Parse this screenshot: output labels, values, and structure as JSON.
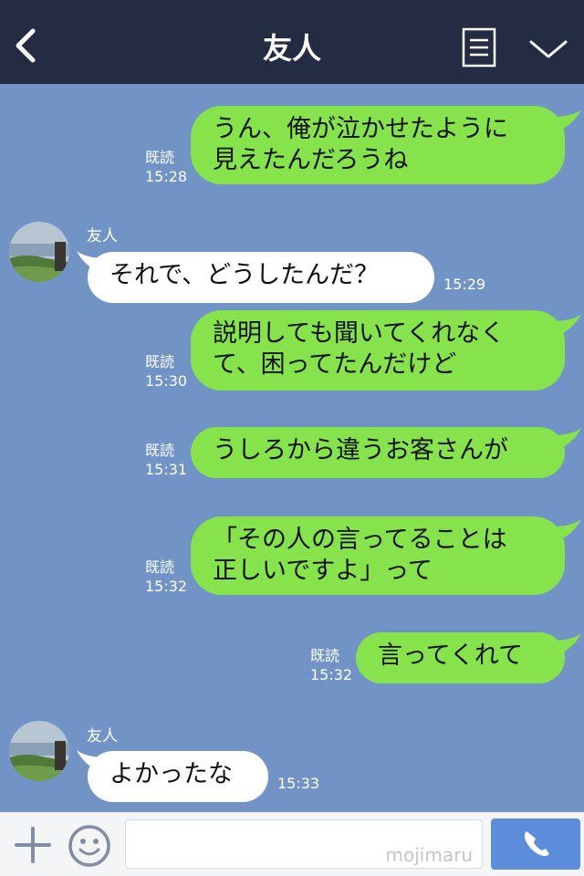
{
  "header": {
    "title": "友人",
    "back_icon": "chevron-left-icon",
    "menu_icon": "menu-icon",
    "collapse_icon": "chevron-down-icon"
  },
  "messages": [
    {
      "side": "out",
      "lines": [
        "うん、俺が泣かせたように",
        "見えたんだろうね"
      ],
      "read": "既読",
      "time": "15:28"
    },
    {
      "side": "in",
      "sender": "友人",
      "lines": [
        "それで、どうしたんだ？"
      ],
      "time": "15:29"
    },
    {
      "side": "out",
      "lines": [
        "説明しても聞いてくれなく",
        "て、困ってたんだけど"
      ],
      "read": "既読",
      "time": "15:30"
    },
    {
      "side": "out",
      "lines": [
        "うしろから違うお客さんが"
      ],
      "read": "既読",
      "time": "15:31"
    },
    {
      "side": "out",
      "lines": [
        "「その人の言ってることは",
        "正しいですよ」って"
      ],
      "read": "既読",
      "time": "15:32"
    },
    {
      "side": "out",
      "lines": [
        "言ってくれて"
      ],
      "read": "既読",
      "time": "15:32"
    },
    {
      "side": "in",
      "sender": "友人",
      "lines": [
        "よかったな"
      ],
      "time": "15:33"
    }
  ],
  "composer": {
    "placeholder": "",
    "watermark": "mojimaru",
    "plus_icon": "plus-icon",
    "emoji_icon": "emoji-icon",
    "call_icon": "phone-icon"
  },
  "colors": {
    "header_bg": "#232c42",
    "chat_bg": "#7193c6",
    "outgoing_bubble": "#86e34b",
    "incoming_bubble": "#ffffff",
    "call_button": "#5b8ddb"
  }
}
